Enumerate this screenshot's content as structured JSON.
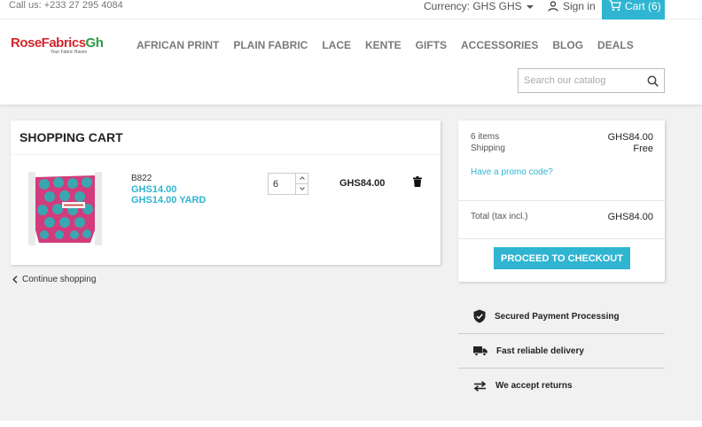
{
  "topbar": {
    "phone": "Call us: +233 27 295 4084",
    "currency": "Currency: GHS GHS",
    "signin": "Sign in",
    "cart": "Cart (6)"
  },
  "header": {
    "logo_rose": "RoseFabrics",
    "logo_gh": "Gh",
    "logo_tagline": "Your Fabric Haven",
    "nav": [
      "AFRICAN PRINT",
      "PLAIN FABRIC",
      "LACE",
      "KENTE",
      "GIFTS",
      "ACCESSORIES",
      "BLOG",
      "DEALS"
    ],
    "search_placeholder": "Search our catalog"
  },
  "cart": {
    "title": "SHOPPING CART",
    "item": {
      "name": "B822",
      "price": "GHS14.00",
      "unit_price": "GHS14.00 YARD",
      "quantity": "6",
      "total": "GHS84.00"
    },
    "continue": "Continue shopping"
  },
  "summary": {
    "items_label": "6 items",
    "items_value": "GHS84.00",
    "shipping_label": "Shipping",
    "shipping_value": "Free",
    "promo": "Have a promo code?",
    "total_label": "Total (tax incl.)",
    "total_value": "GHS84.00",
    "checkout": "PROCEED TO CHECKOUT"
  },
  "reassurance": [
    {
      "icon": "shield-check-icon",
      "label": "Secured Payment Processing"
    },
    {
      "icon": "truck-icon",
      "label": "Fast reliable delivery"
    },
    {
      "icon": "swap-arrows-icon",
      "label": "We accept returns"
    }
  ],
  "colors": {
    "accent": "#2fb5d2",
    "brand_red": "#d0272d",
    "brand_green": "#2e9b45"
  }
}
